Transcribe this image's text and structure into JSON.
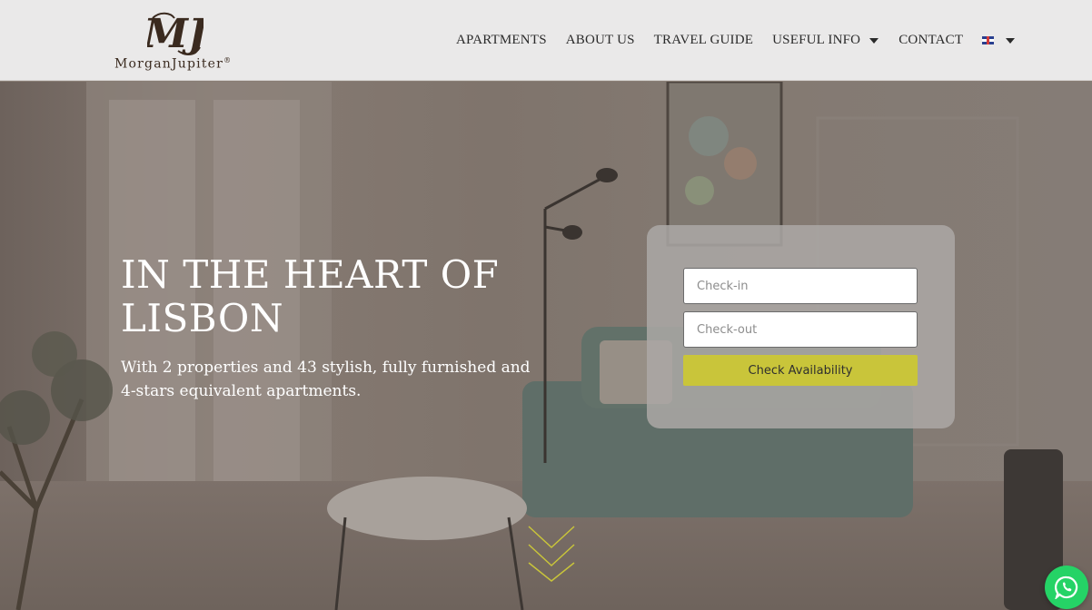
{
  "brand": {
    "monogram": "MJ",
    "name": "MorganJupiter",
    "trademark": "®"
  },
  "nav": {
    "items": [
      {
        "label": "APARTMENTS",
        "has_dropdown": false
      },
      {
        "label": "ABOUT US",
        "has_dropdown": false
      },
      {
        "label": "TRAVEL GUIDE",
        "has_dropdown": false
      },
      {
        "label": "USEFUL INFO",
        "has_dropdown": true
      },
      {
        "label": "CONTACT",
        "has_dropdown": false
      }
    ],
    "language": {
      "flag": "uk-flag-icon",
      "has_dropdown": true
    }
  },
  "hero": {
    "title": "IN THE HEART OF LISBON",
    "subtitle": "With 2 properties and 43 stylish, fully furnished and 4-stars equivalent apartments."
  },
  "booking": {
    "checkin_placeholder": "Check-in",
    "checkin_value": "",
    "checkout_placeholder": "Check-out",
    "checkout_value": "",
    "button_label": "Check Availability"
  },
  "icons": {
    "scroll": "chevrons-down-icon",
    "chat": "whatsapp-icon"
  },
  "colors": {
    "header_bg": "#eae9e9",
    "accent": "#c9c53a",
    "whatsapp": "#25d366",
    "logo_brown": "#3a2a1f"
  }
}
